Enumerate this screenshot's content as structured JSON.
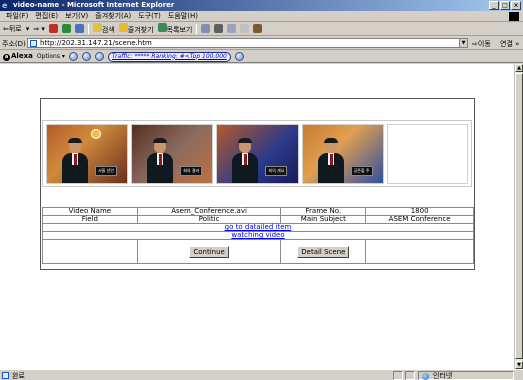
{
  "window": {
    "title": "video-name - Microsoft Internet Explorer",
    "controls": [
      "_",
      "□",
      "×"
    ]
  },
  "menu": [
    "파일(F)",
    "편집(E)",
    "보기(V)",
    "즐겨찾기(A)",
    "도구(T)",
    "도움말(H)"
  ],
  "toolbar": {
    "back": "⇐뒤로",
    "search": "검색",
    "favorites": "즐겨찾기",
    "history": "목록보기"
  },
  "address": {
    "label": "주소(D)",
    "url": "http://202.31.147.21/scene.htm",
    "go": "이동",
    "links": "연결 »"
  },
  "alexa": {
    "logo": "Alexa",
    "options": "Options ▾",
    "traffic": "Traffic: ***** Ranking: #<Top 100,000"
  },
  "thumbnails": [
    {
      "caption": "서울 선언",
      "background": "bg0"
    },
    {
      "caption": "회의 결과",
      "background": "bg1"
    },
    {
      "caption": "회의 개요",
      "background": "bg2"
    },
    {
      "caption": "공존할 주",
      "background": "bg3"
    }
  ],
  "info": {
    "video_name_label": "Video Name",
    "video_name_value": "Asem_Conference.avi",
    "frame_no_label": "Frame No.",
    "frame_no_value": "1800",
    "field_label": "Field",
    "field_value": "Politic",
    "main_subject_label": "Main Subject",
    "main_subject_value": "ASEM Conference",
    "detail_link": "go to datailed item",
    "watch_link": "watching video",
    "continue_button": "Continue",
    "detail_button": "Detail Scene"
  },
  "status": {
    "text": "완료",
    "zone": "인터넷"
  }
}
